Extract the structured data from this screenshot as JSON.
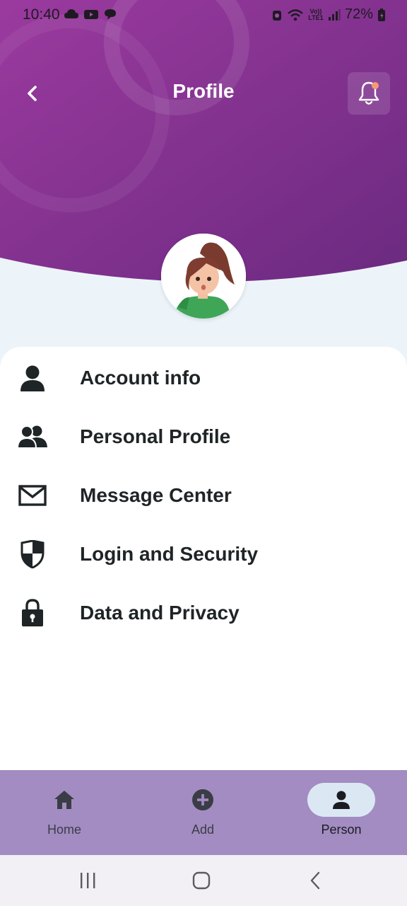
{
  "status_bar": {
    "time": "10:40",
    "battery": "72%",
    "network": "Vo)) LTE1",
    "left_icons": [
      "cloud-icon",
      "youtube-icon",
      "chat-icon"
    ],
    "right_icons": [
      "alarm-icon",
      "wifi-icon",
      "signal-icon",
      "battery-icon"
    ]
  },
  "header": {
    "title": "Profile",
    "back_icon": "chevron-left-icon",
    "notification_icon": "bell-icon",
    "has_notification_dot": true,
    "colors": {
      "gradient_start": "#9a3b9e",
      "gradient_end": "#6a2a80",
      "notification_dot": "#f59a74"
    }
  },
  "avatar": {
    "icon": "avatar-icon"
  },
  "menu": {
    "items": [
      {
        "label": "Account info",
        "icon": "person-icon"
      },
      {
        "label": "Personal Profile",
        "icon": "people-icon"
      },
      {
        "label": "Message Center",
        "icon": "envelope-icon"
      },
      {
        "label": "Login and Security",
        "icon": "shield-icon"
      },
      {
        "label": "Data and Privacy",
        "icon": "lock-icon"
      }
    ]
  },
  "bottom_nav": {
    "items": [
      {
        "label": "Home",
        "icon": "home-icon",
        "active": false
      },
      {
        "label": "Add",
        "icon": "add-circle-icon",
        "active": false
      },
      {
        "label": "Person",
        "icon": "person-icon",
        "active": true
      }
    ],
    "colors": {
      "background": "#a38cc2",
      "active_pill": "#dbe8f4"
    }
  },
  "system_nav": {
    "items": [
      "recent-apps-icon",
      "home-circle-icon",
      "back-icon"
    ]
  }
}
